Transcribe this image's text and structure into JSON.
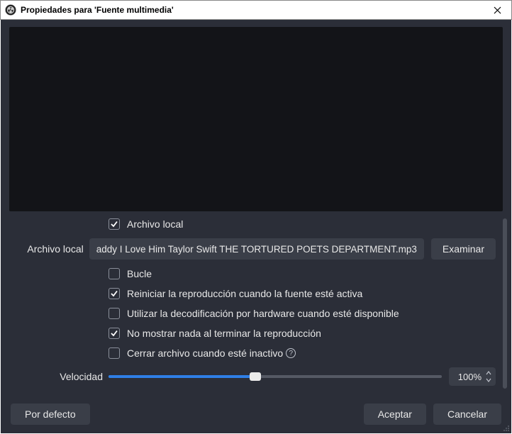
{
  "window": {
    "title": "Propiedades para 'Fuente multimedia'"
  },
  "props": {
    "local_file_checkbox": "Archivo local",
    "local_file_label": "Archivo local",
    "file_value": "addy I Love Him  Taylor Swift THE TORTURED POETS DEPARTMENT.mp3",
    "browse_label": "Examinar",
    "loop_label": "Bucle",
    "restart_label": "Reiniciar la reproducción cuando la fuente esté activa",
    "hw_label": "Utilizar la decodificación por hardware cuando esté disponible",
    "hide_label": "No mostrar nada al terminar la reproducción",
    "close_label": "Cerrar archivo cuando esté inactivo",
    "speed_label": "Velocidad",
    "speed_value": "100%",
    "speed_percent": 44
  },
  "checks": {
    "local_file": true,
    "loop": false,
    "restart": true,
    "hw": false,
    "hide": true,
    "close": false
  },
  "footer": {
    "default_label": "Por defecto",
    "ok_label": "Aceptar",
    "cancel_label": "Cancelar"
  }
}
